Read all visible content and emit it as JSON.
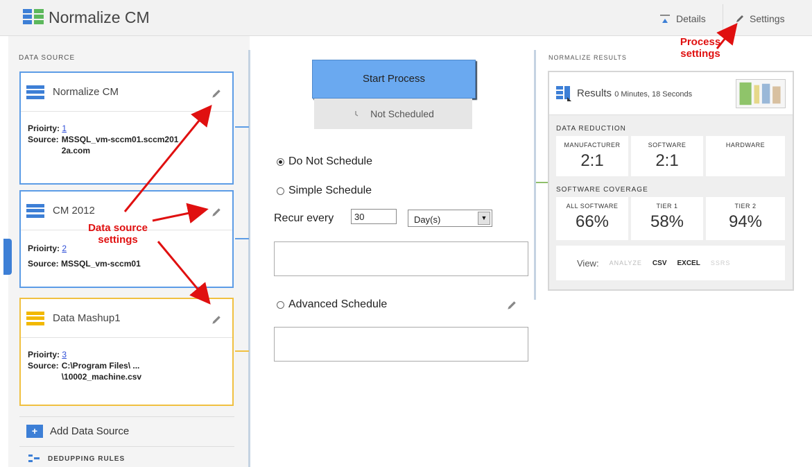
{
  "header": {
    "title": "Normalize CM",
    "details_label": "Details",
    "settings_label": "Settings"
  },
  "data_source": {
    "label": "DATA SOURCE",
    "cards": [
      {
        "name": "Normalize CM",
        "priority_label": "Prioirty:",
        "priority": "1",
        "source_label": "Source:",
        "source_text": "MSSQL_vm-sccm01.sccm2012a.com"
      },
      {
        "name": "CM 2012",
        "priority_label": "Prioirty:",
        "priority": "2",
        "source_label": "Source:",
        "source_text": "MSSQL_vm-sccm01"
      },
      {
        "name": "Data Mashup1",
        "priority_label": "Prioirty:",
        "priority": "3",
        "source_label": "Source:",
        "source_text": "C:\\Program Files\\ ... \\10002_machine.csv"
      }
    ],
    "add_label": "Add Data Source",
    "dedup_label": "DEDUPPING RULES"
  },
  "process": {
    "start_label": "Start Process",
    "status_label": "Not Scheduled",
    "options": {
      "do_not": "Do Not Schedule",
      "simple": "Simple Schedule",
      "advanced": "Advanced Schedule"
    },
    "selected_option": "do_not",
    "recur_label": "Recur every",
    "recur_value": "30",
    "recur_unit": "Day(s)"
  },
  "results": {
    "label": "NORMALIZE RESULTS",
    "title": "Results",
    "duration": "0 Minutes, 18 Seconds",
    "data_reduction": {
      "label": "DATA REDUCTION",
      "metrics": [
        {
          "label": "MANUFACTURER",
          "value": "2:1"
        },
        {
          "label": "SOFTWARE",
          "value": "2:1"
        },
        {
          "label": "HARDWARE",
          "value": ""
        }
      ]
    },
    "software_coverage": {
      "label": "SOFTWARE COVERAGE",
      "metrics": [
        {
          "label": "ALL SOFTWARE",
          "value": "66%"
        },
        {
          "label": "TIER 1",
          "value": "58%"
        },
        {
          "label": "TIER 2",
          "value": "94%"
        }
      ]
    },
    "view": {
      "label": "View:",
      "options": [
        "ANALYZE",
        "CSV",
        "EXCEL",
        "SSRS"
      ]
    }
  },
  "annotations": {
    "process_settings": "Process settings",
    "data_source_settings": "Data source settings"
  },
  "colors": {
    "accent_blue": "#3d7fd6",
    "button_blue": "#6aa9f0",
    "mashup_yellow": "#f2b800",
    "annotation_red": "#e01010"
  }
}
